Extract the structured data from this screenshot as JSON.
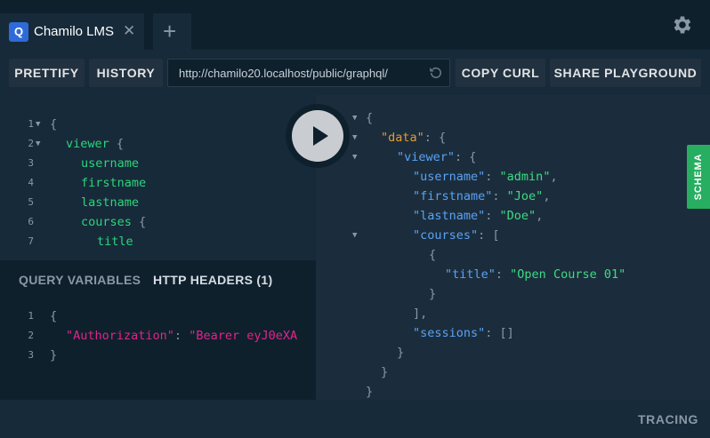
{
  "tab": {
    "badge": "Q",
    "title": "Chamilo LMS",
    "close": "✕",
    "add": "+"
  },
  "toolbar": {
    "prettify": "PRETTIFY",
    "history": "HISTORY",
    "url": "http://chamilo20.localhost/public/graphql/",
    "copy_curl": "COPY CURL",
    "share": "SHARE PLAYGROUND"
  },
  "query": {
    "lines": [
      {
        "n": "1",
        "text": "{"
      },
      {
        "n": "2",
        "field": "viewer",
        "brace": "{"
      },
      {
        "n": "3",
        "field": "username"
      },
      {
        "n": "4",
        "field": "firstname"
      },
      {
        "n": "5",
        "field": "lastname"
      },
      {
        "n": "6",
        "field": "courses",
        "brace": "{"
      },
      {
        "n": "7",
        "field": "title"
      }
    ]
  },
  "vars": {
    "tab_variables": "QUERY VARIABLES",
    "tab_headers": "HTTP HEADERS (1)",
    "header_key": "\"Authorization\"",
    "header_value": "\"Bearer eyJ0eXA"
  },
  "result": {
    "data_key": "\"data\"",
    "viewer_key": "\"viewer\"",
    "username_key": "\"username\"",
    "username": "\"admin\"",
    "firstname_key": "\"firstname\"",
    "firstname": "\"Joe\"",
    "lastname_key": "\"lastname\"",
    "lastname": "\"Doe\"",
    "courses_key": "\"courses\"",
    "title_key": "\"title\"",
    "title": "\"Open Course 01\"",
    "sessions_key": "\"sessions\"",
    "sessions": "[]"
  },
  "schema_tab": "SCHEMA",
  "footer": {
    "tracing": "TRACING"
  },
  "colors": {
    "bg": "#0f202d",
    "panel": "#172a3a",
    "schema": "#27ae60",
    "badge": "#2f6bd8"
  }
}
